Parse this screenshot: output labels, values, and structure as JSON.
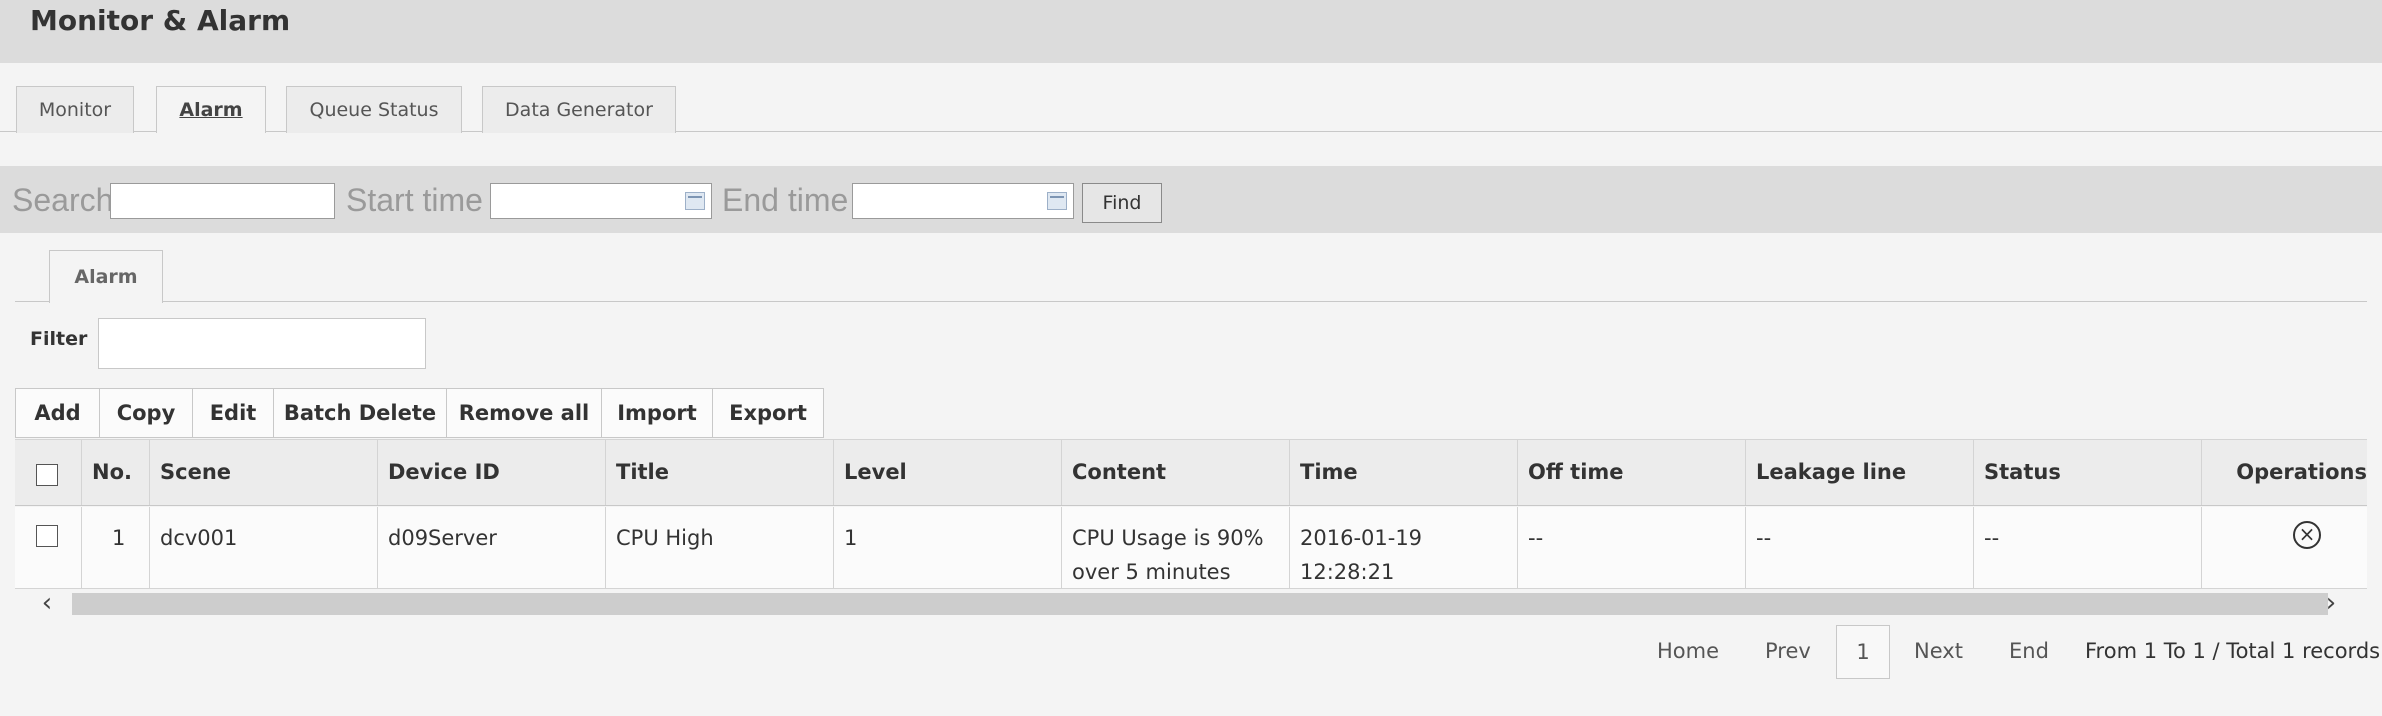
{
  "header": {
    "title": "Monitor & Alarm"
  },
  "top_tabs": [
    "Monitor",
    "Alarm",
    "Queue Status",
    "Data Generator"
  ],
  "search": {
    "search_label": "Search",
    "start_label": "Start time",
    "end_label": "End time",
    "find_label": "Find"
  },
  "sub_tab": "Alarm",
  "filter": {
    "label": "Filter",
    "value": ""
  },
  "toolbar": [
    "Add",
    "Copy",
    "Edit",
    "Batch Delete",
    "Remove all",
    "Import",
    "Export"
  ],
  "table": {
    "columns": [
      "No.",
      "Scene",
      "Device ID",
      "Title",
      "Level",
      "Content",
      "Time",
      "Off time",
      "Leakage line",
      "Status",
      "Operations"
    ],
    "rows": [
      {
        "no": "1",
        "scene": "dcv001",
        "device_id": "d09Server",
        "title": "CPU High",
        "level": "1",
        "content_line1": "CPU Usage is 90%",
        "content_line2": "over 5 minutes",
        "time": "2016-01-19 12:28:21",
        "off_time": "--",
        "leakage_line": "--",
        "status": "--"
      }
    ]
  },
  "pager": {
    "home": "Home",
    "prev": "Prev",
    "current": "1",
    "next": "Next",
    "end": "End",
    "summary": "From 1 To 1 / Total 1 records"
  },
  "icons": {
    "calendar": "calendar-icon",
    "delete": "close-circle-icon",
    "scroll_left": "chevron-left-icon",
    "scroll_right": "chevron-right-icon"
  }
}
